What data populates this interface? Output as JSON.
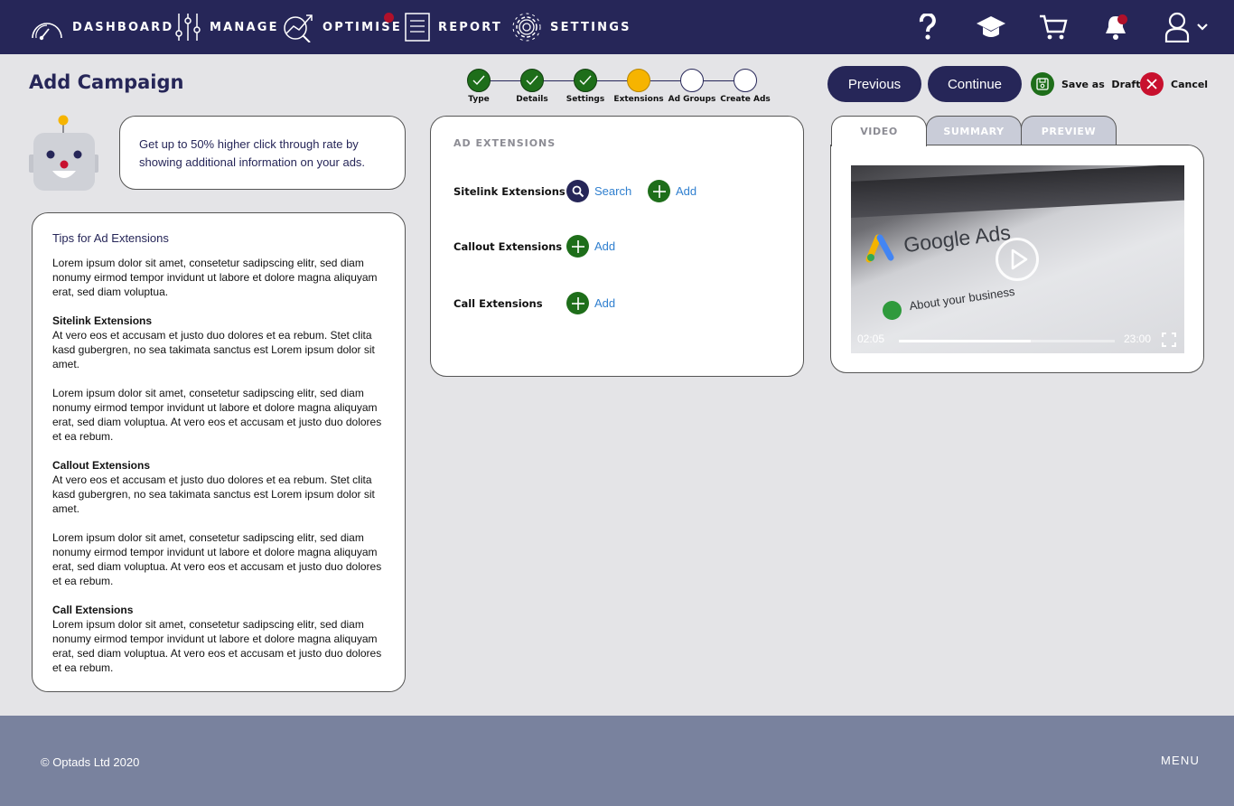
{
  "nav": {
    "items": [
      {
        "label": "DASHBOARD",
        "icon": "speedometer-icon"
      },
      {
        "label": "MANAGE",
        "icon": "sliders-icon"
      },
      {
        "label": "OPTIMISE",
        "icon": "trend-chart-icon",
        "has_alert": true
      },
      {
        "label": "REPORT",
        "icon": "document-icon"
      },
      {
        "label": "SETTINGS",
        "icon": "gear-icon"
      }
    ],
    "right_icons": [
      "help-icon",
      "graduation-cap-icon",
      "cart-icon",
      "bell-icon",
      "user-icon"
    ],
    "bell_has_alert": true
  },
  "page": {
    "title": "Add Campaign"
  },
  "stepper": {
    "steps": [
      {
        "label": "Type",
        "state": "done"
      },
      {
        "label": "Details",
        "state": "done"
      },
      {
        "label": "Settings",
        "state": "done"
      },
      {
        "label": "Extensions",
        "state": "current"
      },
      {
        "label": "Ad Groups",
        "state": "todo"
      },
      {
        "label": "Create Ads",
        "state": "todo"
      }
    ]
  },
  "actions": {
    "previous": "Previous",
    "continue": "Continue",
    "save_draft": "Save as  Draft",
    "cancel": "Cancel"
  },
  "tip": {
    "text": "Get up to 50% higher click through rate by showing additional information on your ads."
  },
  "tips_card": {
    "title": "Tips for Ad Extensions",
    "intro": "Lorem ipsum dolor sit amet, consetetur sadipscing elitr, sed diam nonumy eirmod tempor invidunt ut labore et dolore magna aliquyam erat, sed diam voluptua.",
    "sections": [
      {
        "heading": "Sitelink Extensions",
        "body": "At vero eos et accusam et justo duo dolores et ea rebum. Stet clita kasd gubergren, no sea takimata sanctus est Lorem ipsum dolor sit amet.",
        "extra": "Lorem ipsum dolor sit amet, consetetur sadipscing elitr, sed diam nonumy eirmod tempor invidunt ut labore et dolore magna aliquyam erat, sed diam voluptua. At vero eos et accusam et justo duo dolores et ea rebum."
      },
      {
        "heading": "Callout Extensions",
        "body": "At vero eos et accusam et justo duo dolores et ea rebum. Stet clita kasd gubergren, no sea takimata sanctus est Lorem ipsum dolor sit amet.",
        "extra": "Lorem ipsum dolor sit amet, consetetur sadipscing elitr, sed diam nonumy eirmod tempor invidunt ut labore et dolore magna aliquyam erat, sed diam voluptua. At vero eos et accusam et justo duo dolores et ea rebum."
      },
      {
        "heading": "Call Extensions",
        "body": "Lorem ipsum dolor sit amet, consetetur sadipscing elitr, sed diam nonumy eirmod tempor invidunt ut labore et dolore magna aliquyam erat, sed diam voluptua. At vero eos et accusam et justo duo dolores et ea rebum."
      }
    ]
  },
  "extensions": {
    "heading": "AD EXTENSIONS",
    "rows": [
      {
        "label": "Sitelink Extensions",
        "search": "Search",
        "add": "Add"
      },
      {
        "label": "Callout Extensions",
        "add": "Add"
      },
      {
        "label": "Call Extensions",
        "add": "Add"
      }
    ]
  },
  "media": {
    "tabs": [
      "VIDEO",
      "SUMMARY",
      "PREVIEW"
    ],
    "active_tab": "VIDEO",
    "video": {
      "brand_text": "Google Ads",
      "caption_text": "About your business",
      "current_time": "02:05",
      "total_time": "23:00",
      "progress_fraction": 0.61
    }
  },
  "footer": {
    "copyright": "© Optads Ltd 2020",
    "menu": "MENU"
  },
  "colors": {
    "navy": "#262658",
    "green": "#1e6e1a",
    "step_current": "#f6b400",
    "alert_red": "#b0102a",
    "cancel_red": "#c8102e",
    "link_blue": "#2f7fcf",
    "footer": "#79829e"
  }
}
